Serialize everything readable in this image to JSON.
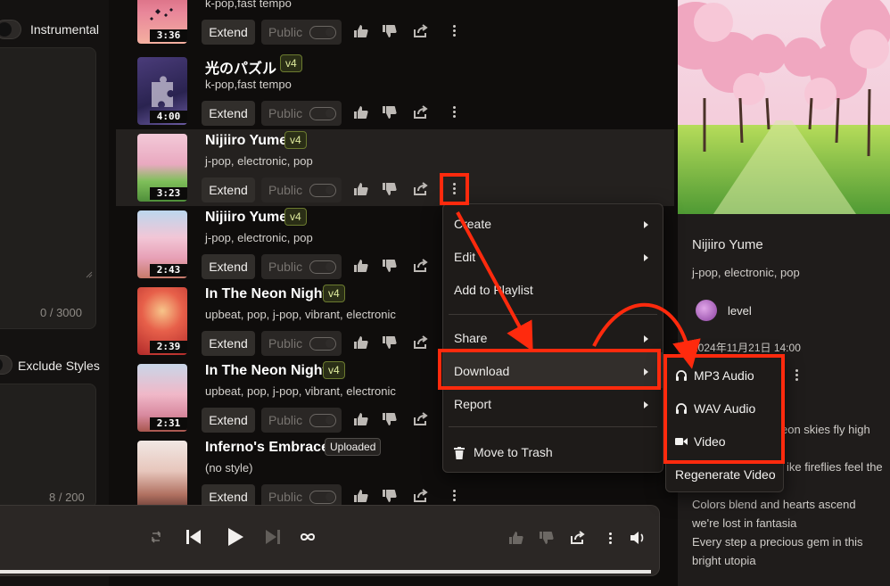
{
  "left_panel": {
    "instrumental_label": "Instrumental",
    "lyrics_counter": "0 / 3000",
    "exclude_styles_label": "Exclude Styles",
    "styles_counter": "8 / 200"
  },
  "songs": [
    {
      "title": "",
      "version": "",
      "tags": "k-pop,fast tempo",
      "duration": "3:36",
      "extend": "Extend",
      "public": "Public"
    },
    {
      "title": "光のパズル",
      "version": "v4",
      "tags": "k-pop,fast tempo",
      "duration": "4:00",
      "extend": "Extend",
      "public": "Public"
    },
    {
      "title": "Nijiiro Yume",
      "version": "v4",
      "tags": "j-pop, electronic, pop",
      "duration": "3:23",
      "extend": "Extend",
      "public": "Public"
    },
    {
      "title": "Nijiiro Yume",
      "version": "v4",
      "tags": "j-pop, electronic, pop",
      "duration": "2:43",
      "extend": "Extend",
      "public": "Public"
    },
    {
      "title": "In The Neon Night",
      "version": "v4",
      "tags": "upbeat, pop, j-pop, vibrant, electronic",
      "duration": "2:39",
      "extend": "Extend",
      "public": "Public"
    },
    {
      "title": "In The Neon Night",
      "version": "v4",
      "tags": "upbeat, pop, j-pop, vibrant, electronic",
      "duration": "2:31",
      "extend": "Extend",
      "public": "Public"
    },
    {
      "title": "Inferno's Embrace",
      "version": "Uploaded",
      "tags": "(no style)",
      "duration": "",
      "extend": "Extend",
      "public": "Public"
    }
  ],
  "context_menu": {
    "create": "Create",
    "edit": "Edit",
    "add_to_playlist": "Add to Playlist",
    "share": "Share",
    "download": "Download",
    "report": "Report",
    "move_to_trash": "Move to Trash"
  },
  "download_submenu": {
    "mp3": "MP3 Audio",
    "wav": "WAV Audio",
    "video": "Video",
    "regenerate": "Regenerate Video"
  },
  "detail_panel": {
    "title": "Nijiiro Yume",
    "tags": "j-pop,  electronic,  pop",
    "user": "level",
    "date": "2024年11月21日 14:00",
    "lyrics": [
      "eon skies fly high",
      "ike fireflies feel the",
      "Colors blend and hearts ascend",
      "we're lost in fantasia",
      "Every step a precious gem in this",
      "bright utopia"
    ]
  },
  "colors": {
    "annotation": "#ff2a0d",
    "version_badge": "#e0ec9e"
  },
  "icons": [
    "thumbs-up-icon",
    "thumbs-down-icon",
    "share-icon",
    "more-icon",
    "headphones-icon",
    "video-camera-icon",
    "trash-icon",
    "repeat-icon",
    "prev-icon",
    "play-icon",
    "next-icon",
    "loop-icon",
    "volume-icon"
  ]
}
